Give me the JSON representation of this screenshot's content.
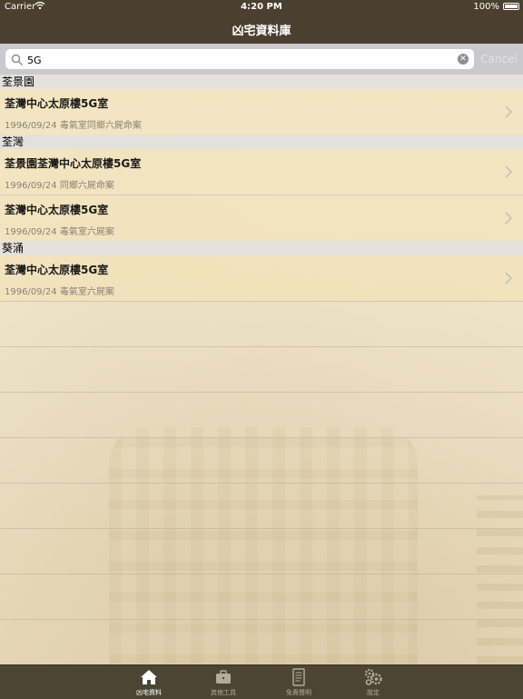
{
  "status_bar": {
    "carrier": "Carrier",
    "time": "4:20 PM",
    "battery": "100%"
  },
  "nav": {
    "title": "凶宅資料庫"
  },
  "search": {
    "value": "5G",
    "cancel_label": "Cancel"
  },
  "sections": [
    {
      "header": "荃景園",
      "rows": [
        {
          "title": "荃灣中心太原樓5G室",
          "subtitle": "1996/09/24 毒氣室同鄉六屍命案"
        }
      ]
    },
    {
      "header": "荃灣",
      "rows": [
        {
          "title": "荃景園荃灣中心太原樓5G室",
          "subtitle": "1996/09/24 同鄉六屍命案"
        },
        {
          "title": "荃灣中心太原樓5G室",
          "subtitle": "1996/09/24 毒氣室六屍案"
        }
      ]
    },
    {
      "header": "葵涌",
      "rows": [
        {
          "title": "荃灣中心太原樓5G室",
          "subtitle": "1996/09/24 毒氣室六屍案"
        }
      ]
    }
  ],
  "tabs": [
    {
      "label": "凶宅資料",
      "icon": "home-icon",
      "active": true
    },
    {
      "label": "其他工具",
      "icon": "briefcase-icon",
      "active": false
    },
    {
      "label": "免責聲明",
      "icon": "document-icon",
      "active": false
    },
    {
      "label": "設定",
      "icon": "gears-icon",
      "active": false
    }
  ],
  "colors": {
    "bar_background": "#4a4030",
    "section_header": "#e4e1dc",
    "row_tint": "#f2e2b7",
    "subtitle_text": "#8a8175"
  }
}
